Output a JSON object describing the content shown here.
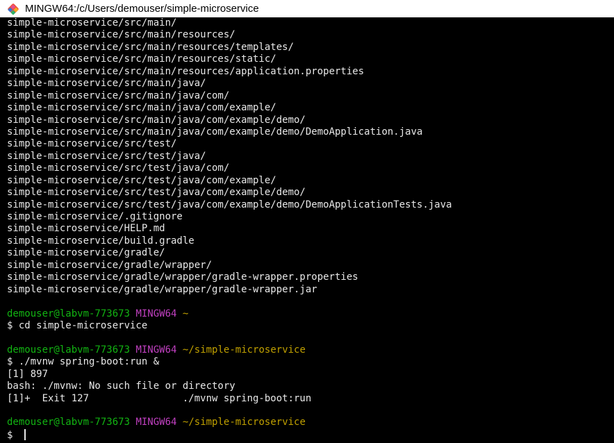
{
  "window": {
    "title": "MINGW64:/c/Users/demouser/simple-microservice"
  },
  "colors": {
    "user_host": "#12b412",
    "shell_name": "#c040c0",
    "path": "#c0a000",
    "text": "#e8e8e8",
    "background": "#000000"
  },
  "terminal": {
    "output_lines": [
      "simple-microservice/src/main/",
      "simple-microservice/src/main/resources/",
      "simple-microservice/src/main/resources/templates/",
      "simple-microservice/src/main/resources/static/",
      "simple-microservice/src/main/resources/application.properties",
      "simple-microservice/src/main/java/",
      "simple-microservice/src/main/java/com/",
      "simple-microservice/src/main/java/com/example/",
      "simple-microservice/src/main/java/com/example/demo/",
      "simple-microservice/src/main/java/com/example/demo/DemoApplication.java",
      "simple-microservice/src/test/",
      "simple-microservice/src/test/java/",
      "simple-microservice/src/test/java/com/",
      "simple-microservice/src/test/java/com/example/",
      "simple-microservice/src/test/java/com/example/demo/",
      "simple-microservice/src/test/java/com/example/demo/DemoApplicationTests.java",
      "simple-microservice/.gitignore",
      "simple-microservice/HELP.md",
      "simple-microservice/build.gradle",
      "simple-microservice/gradle/",
      "simple-microservice/gradle/wrapper/",
      "simple-microservice/gradle/wrapper/gradle-wrapper.properties",
      "simple-microservice/gradle/wrapper/gradle-wrapper.jar"
    ],
    "blocks": [
      {
        "prompt": {
          "user_host": "demouser@labvm-773673",
          "shell": "MINGW64",
          "path": "~"
        },
        "command": "$ cd simple-microservice",
        "output": []
      },
      {
        "prompt": {
          "user_host": "demouser@labvm-773673",
          "shell": "MINGW64",
          "path": "~/simple-microservice"
        },
        "command": "$ ./mvnw spring-boot:run &",
        "output": [
          "[1] 897",
          "bash: ./mvnw: No such file or directory",
          "[1]+  Exit 127                ./mvnw spring-boot:run"
        ]
      }
    ],
    "final_prompt": {
      "user_host": "demouser@labvm-773673",
      "shell": "MINGW64",
      "path": "~/simple-microservice",
      "input_prefix": "$ "
    }
  }
}
